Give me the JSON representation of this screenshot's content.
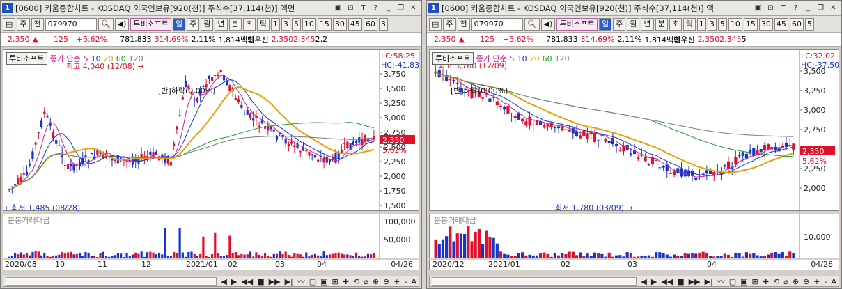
{
  "windows": [
    {
      "title_num": "1",
      "title": "[0600] 키움종합차트 - KOSDAQ 외국인보유[920(천)] 주식수[37,114(천)] 액면",
      "toolbar": {
        "chart_sel": "주",
        "chart_type": "전",
        "code": "079970",
        "name": "투비소프트",
        "periods": [
          "일",
          "주",
          "월",
          "년",
          "분",
          "초",
          "틱"
        ],
        "active": "일",
        "nums": [
          "1",
          "3",
          "5",
          "10",
          "15",
          "30",
          "45",
          "60",
          "3"
        ]
      },
      "quote": {
        "price": "2,350",
        "arrow": "▲",
        "change": "125",
        "pct": "+5.62%",
        "volume": "781,833",
        "ratio": "314.69%",
        "turnover": "2.11%",
        "amount": "1,814백만",
        "best": "최우선",
        "bid": "2,350",
        "ask": "2,345",
        "extra": "2,2"
      },
      "legend": {
        "name": "투비소프트",
        "ma_label": "종가 단순",
        "periods": [
          "5",
          "10",
          "20",
          "60",
          "120"
        ]
      },
      "lc": "LC:58.25",
      "hc": "HC:-41.83",
      "price_label": "2,350",
      "pct_label": "5.62%",
      "high_label": "최고 4,040 (12/08)",
      "low_label": "최저 1,485 (08/28)",
      "anno": "[반]하락(0.00%)",
      "volume_label": "분봉거래대금",
      "vol_ticks": [
        "100,000",
        "50,000"
      ],
      "price_ticks": [
        "3,750",
        "3,500",
        "3,250",
        "3,000",
        "2,750",
        "2,500",
        "2,250",
        "2,000",
        "1,750",
        "1,500"
      ],
      "x_ticks": [
        "2020/08",
        "10",
        "11",
        "12",
        "2021/01",
        "02",
        "03",
        "04"
      ],
      "x_right": "04/26",
      "bottom": [
        "◀",
        "▶",
        "◀◀",
        "■",
        "▶▶",
        "▶|",
        "+",
        "-",
        "A"
      ]
    },
    {
      "title_num": "1",
      "title": "[0600] 키움종합차트 - KOSDAQ 외국인보유[920(천)] 주식수[37,114(천)] 액",
      "toolbar": {
        "chart_sel": "주",
        "chart_type": "전",
        "code": "079970",
        "name": "투비소프트",
        "periods": [
          "일",
          "주",
          "월",
          "년",
          "분",
          "초",
          "틱"
        ],
        "active": "일",
        "nums": [
          "1",
          "3",
          "5",
          "10",
          "15",
          "30",
          "45",
          "60",
          "5"
        ]
      },
      "quote": {
        "price": "2,350",
        "arrow": "▲",
        "change": "125",
        "pct": "+5.62%",
        "volume": "781,833",
        "ratio": "314.69%",
        "turnover": "2.11%",
        "amount": "1,814백만",
        "best": "최우선",
        "bid": "2,350",
        "ask": "2,345",
        "extra": "5"
      },
      "legend": {
        "name": "투비소프트",
        "ma_label": "종가 단순",
        "periods": [
          "5",
          "10",
          "20",
          "60",
          "120"
        ]
      },
      "lc": "LC:32.02",
      "hc": "HC:-37.50",
      "price_label": "2,350",
      "pct_label": "5.62%",
      "high_label": "최고 3,760 (12/09)",
      "low_label": "최저 1,780 (03/09)",
      "anno": "[반]하락(0.00%)",
      "volume_label": "분봉거래대금",
      "vol_ticks": [
        "10,000"
      ],
      "price_ticks": [
        "3,500",
        "3,250",
        "3,000",
        "2,750",
        "2,500",
        "2,250",
        "2,000"
      ],
      "x_ticks": [
        "2020/12",
        "2021/01",
        "02",
        "03",
        "04"
      ],
      "x_right": "04/26",
      "bottom": [
        "◀",
        "▶",
        "◀◀",
        "■",
        "▶▶",
        "▶|",
        "+",
        "-",
        "A"
      ]
    }
  ],
  "colors": {
    "up": "#e0102a",
    "down": "#1535d0",
    "ma5": "#d02090",
    "ma10": "#1535d0",
    "ma20": "#e8a000",
    "ma60": "#1f9a2a",
    "ma120": "#7a7a7a"
  }
}
